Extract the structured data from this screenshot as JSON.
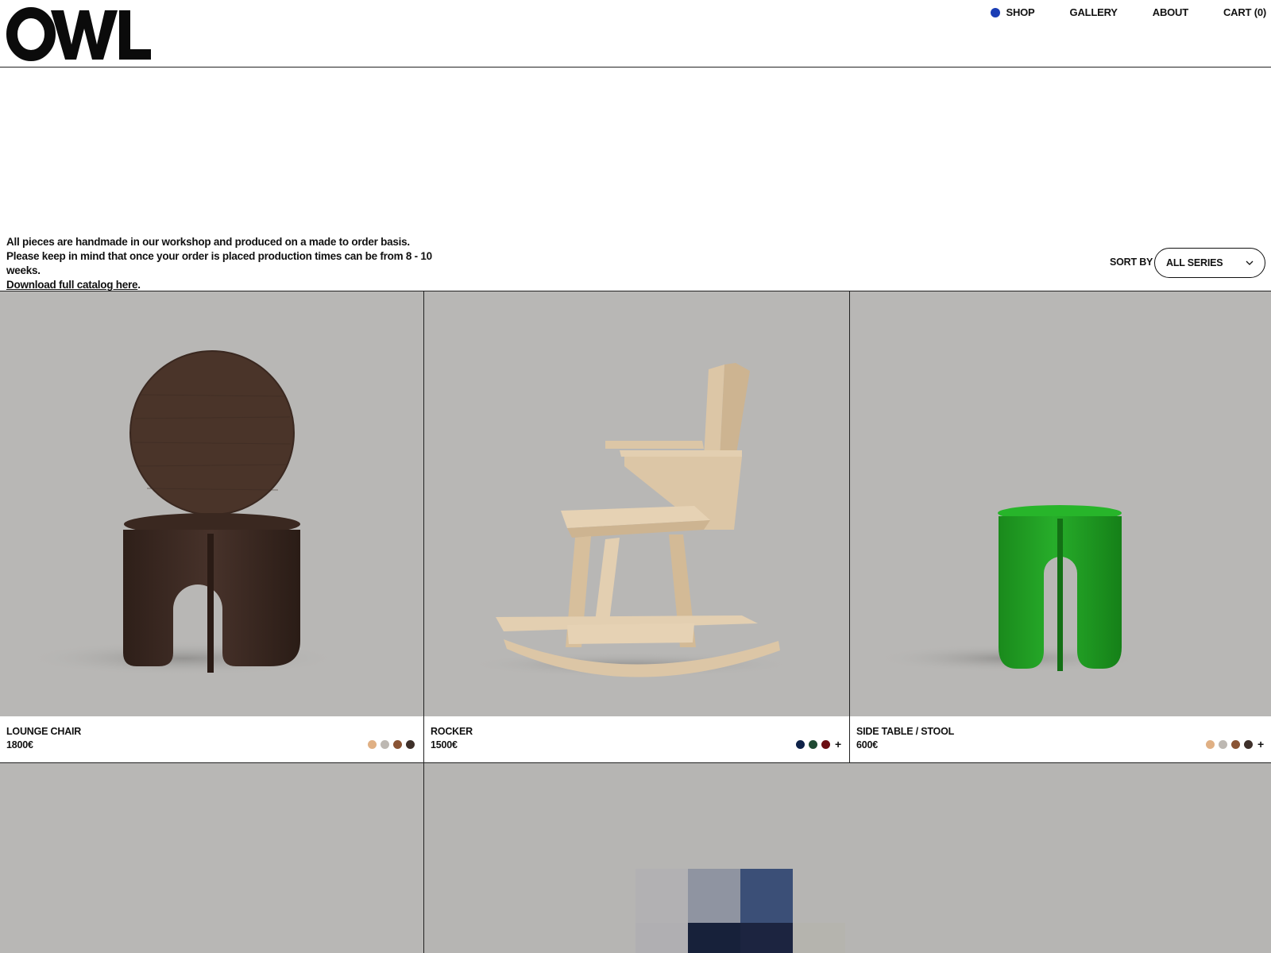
{
  "brand": {
    "name": "OWL"
  },
  "nav": {
    "shop": "SHOP",
    "gallery": "GALLERY",
    "about": "ABOUT",
    "cart": "CART (0)",
    "active_dot_color": "#1a3db5"
  },
  "intro": {
    "text": "All pieces are handmade in our workshop and produced on a made to order basis. Please keep in mind that once your order is placed production times can be from 8 - 10 weeks.",
    "link_text": "Download full catalog here",
    "link_suffix": "."
  },
  "sort": {
    "label": "SORT BY",
    "selected": "ALL SERIES"
  },
  "products": [
    {
      "name": "LOUNGE CHAIR",
      "price": "1800€",
      "swatches": [
        "#e0b084",
        "#bdb8b2",
        "#8a5434",
        "#3e302a"
      ],
      "more": ""
    },
    {
      "name": "ROCKER",
      "price": "1500€",
      "swatches": [
        "#0e2248",
        "#1f4a32",
        "#6b0e12"
      ],
      "more": "+"
    },
    {
      "name": "SIDE TABLE / STOOL",
      "price": "600€",
      "swatches": [
        "#e0b084",
        "#bdb8b2",
        "#8a5434",
        "#3e302a"
      ],
      "more": "+"
    }
  ],
  "colors": {
    "image_bg": "#b8b7b5",
    "lounge_wood": "#3d2a22",
    "rocker_wood": "#dcc6a6",
    "stool_green": "#1f9a22"
  }
}
